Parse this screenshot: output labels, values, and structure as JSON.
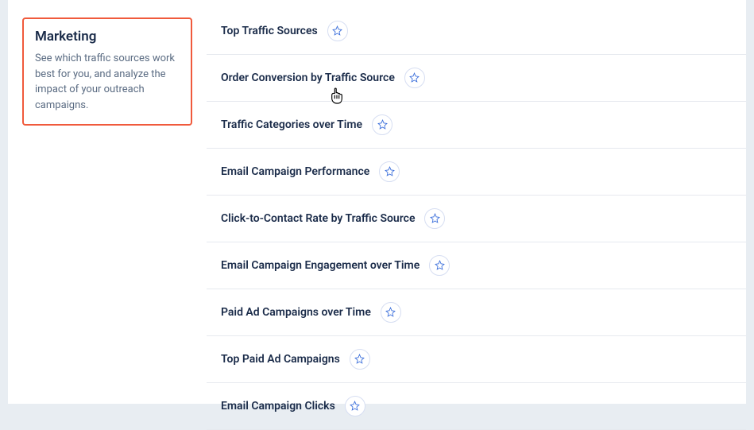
{
  "sidebar": {
    "title": "Marketing",
    "description": "See which traffic sources work best for you, and analyze the impact of your outreach campaigns."
  },
  "reports": [
    {
      "title": "Top Traffic Sources"
    },
    {
      "title": "Order Conversion by Traffic Source"
    },
    {
      "title": "Traffic Categories over Time"
    },
    {
      "title": "Email Campaign Performance"
    },
    {
      "title": "Click-to-Contact Rate by Traffic Source"
    },
    {
      "title": "Email Campaign Engagement over Time"
    },
    {
      "title": "Paid Ad Campaigns over Time"
    },
    {
      "title": "Top Paid Ad Campaigns"
    },
    {
      "title": "Email Campaign Clicks"
    }
  ],
  "colors": {
    "highlight_border": "#f05a3c",
    "accent": "#3b6fdb"
  }
}
